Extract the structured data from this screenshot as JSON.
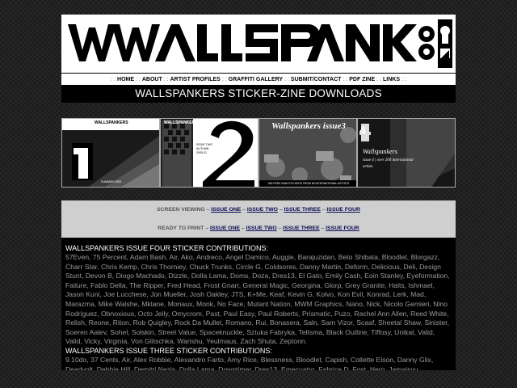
{
  "site": {
    "logo_text": "WALLSPANKERS"
  },
  "nav": {
    "items": [
      {
        "label": "HOME"
      },
      {
        "label": "ABOUT"
      },
      {
        "label": "ARTIST PROFILES"
      },
      {
        "label": "GRAFFITI GALLERY"
      },
      {
        "label": "SUBMIT/CONTACT"
      },
      {
        "label": "PDF ZINE"
      },
      {
        "label": "LINKS"
      }
    ],
    "separator": ": :"
  },
  "page_title": "WALLSPANKERS STICKER-ZINE DOWNLOADS",
  "covers": [
    {
      "label": "WALLSPANKERS",
      "number": "1",
      "sub": "SUMMER 2005"
    },
    {
      "label": "WALLSPANKERS",
      "number": "2",
      "sub": "ISSUE TWO AUTUMN 2005 01"
    },
    {
      "label": "Wallspankers issue3",
      "sub": "250 FREE RAW STICKERS FROM 80 INTERNATIONAL ARTISTS"
    },
    {
      "label": "Wallspankers",
      "number": "4",
      "sub": "issue 4 | over 200 international artists"
    }
  ],
  "downloads": {
    "screen_label": "SCREEN VIEWING –",
    "print_label": "READY TO PRINT –",
    "dash": "–",
    "issue_links": [
      "ISSUE ONE",
      "ISSUE TWO",
      "ISSUE THREE",
      "ISSUE FOUR"
    ]
  },
  "contributions": {
    "issue_four_heading": "WALLSPANKERS ISSUE FOUR STICKER CONTRIBUTIONS:",
    "issue_four_names": "57Even, 75 Percent, Adam Bash, Air, Ako, Andreco, Angel Damico, Auggie, Barajuzidan, Beto Shibata, Bloodlet, Blorgazz, Charr Star, Chris Kemp, Chris Thorniey, Chuck Trunks, Circle G, Coldsores, Danny Martin, Deform, Delicious, Deli, Design Stunt, Devon B, Diogo Machado, Dizzle, Dolla Lama, Doms, Doza, Dres13, El Gato, Emily Cash, Eoin Stanley, Eyeformation, Failure, Fablo Della, The Ripper, Fred Head, Frost Gnarr, General Magic, Georgina, Glorp, Grey Granite, Halts, Ishmael, Jason Kuni, Joe Lucchese, Jon Mueller, Josh Oakley, JTS, K+Me, Keaf, Kevin G, Kolvo, Kon Evil, Konrad, Lerk, Mad, Marazma, Mike Walshe, Mklane, Monaux, Monk, No Face, Mutant Nation, MWM Graphics, Nano, Nick, Nicolo Gemieri, Nino Rodriguez, Obnoxious, Octo Jelly, Omycrom, Past, Paul Easy, Paul Roberts, Prismatic, Puzo, Rachel Ann Allen, Reed White, Relish, Reone, Riton, Rob Quigley, Rock Da Mullet, Romano, Rui, Bonasera, Saln, Sam Vizor, Scaaf, Sheetal Shaw, Sinister, Soeren Aalev, Sohel, Solskin, Street Value, Spaceknuckle, Sztuka Fabryka, Teltsma, Black Outline, Tiffosy, Unikat, Valid, Valid, Vicky, Virginia, Von Glitschka, Warishu, Yeulmaus, Zach Shuta, Zeptonn.",
    "issue_three_heading": "WALLSPANKERS ISSUE THREE STICKER CONTRIBUTIONS:",
    "issue_three_names": "9.10do, 37 Cents, Air, Alex Robbie, Alexandro Farto, Amy Rice, Blessness, Bloodlet, Capish, Collette Elson, Danny Glix, Deadvolt, Debbie Hill, Demitri Nezis, Dolla Lama, Downtimer, Dres13, Emecuatro, Fabrice D, Fost, Hero, Jamaisvu,"
  },
  "colors": {
    "background": "#1c1c1c",
    "panel": "#cfcfcf",
    "link": "#0a0a55",
    "names_text": "#9a9a9a"
  }
}
